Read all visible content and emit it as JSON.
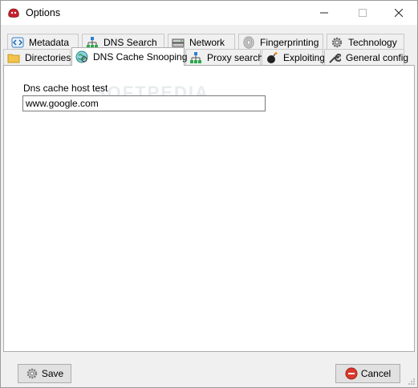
{
  "window": {
    "title": "Options"
  },
  "tabs_row1": [
    {
      "label": "Metadata",
      "icon": "code-icon"
    },
    {
      "label": "DNS Search",
      "icon": "network-tree-icon"
    },
    {
      "label": "Network",
      "icon": "server-icon"
    },
    {
      "label": "Fingerprinting",
      "icon": "fingerprint-icon"
    },
    {
      "label": "Technology",
      "icon": "gear-icon"
    }
  ],
  "tabs_row2": [
    {
      "label": "Directories",
      "icon": "folder-icon"
    },
    {
      "label": "DNS Cache Snooping",
      "icon": "globe-icon",
      "active": true
    },
    {
      "label": "Proxy search",
      "icon": "network-tree-icon"
    },
    {
      "label": "Exploiting",
      "icon": "bomb-icon"
    },
    {
      "label": "General config",
      "icon": "wrench-icon"
    }
  ],
  "panel": {
    "field_label": "Dns cache host test",
    "host_value": "www.google.com",
    "watermark": "SOFTPEDIA"
  },
  "buttons": {
    "save": "Save",
    "cancel": "Cancel"
  },
  "colors": {
    "accent_red": "#d9382c",
    "tab_border": "#c8c8c8"
  }
}
